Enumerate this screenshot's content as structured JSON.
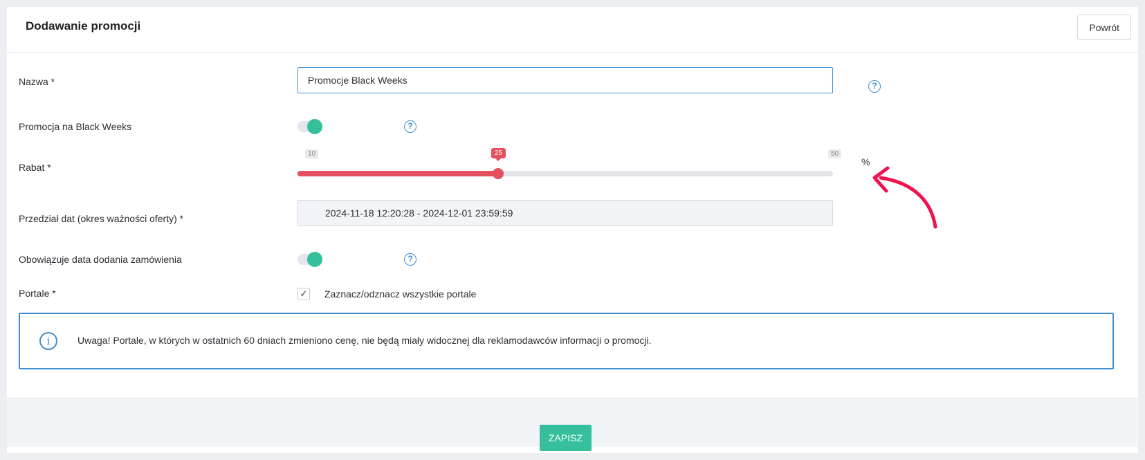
{
  "header": {
    "title": "Dodawanie promocji",
    "back_label": "Powrót"
  },
  "form": {
    "name": {
      "label": "Nazwa *",
      "value": "Promocje Black Weeks"
    },
    "black_weeks": {
      "label": "Promocja na Black Weeks",
      "enabled": true
    },
    "discount": {
      "label": "Rabat *",
      "min": "10",
      "max": "50",
      "value": "25",
      "unit": "%"
    },
    "date_range": {
      "label": "Przedział dat (okres ważności oferty) *",
      "value": "2024-11-18 12:20:28 - 2024-12-01 23:59:59"
    },
    "order_date": {
      "label": "Obowiązuje data dodania zamówienia",
      "enabled": true
    },
    "portals": {
      "label": "Portale *",
      "checkbox_label": "Zaznacz/odznacz wszystkie portale",
      "checked": true
    }
  },
  "notice": {
    "text": "Uwaga! Portale, w których w ostatnich 60 dniach zmieniono cenę, nie będą miały widocznej dla reklamodawców informacji o promocji."
  },
  "footer": {
    "save_label": "ZAPISZ"
  },
  "icons": {
    "help": "question-circle-icon",
    "info": "info-circle-icon",
    "check": "check-icon",
    "annotation": "red-curved-arrow"
  },
  "colors": {
    "accent_blue": "#3d8fd1",
    "toggle_green": "#35bf9b",
    "slider_red": "#e5505e",
    "annotation_red": "#f0134f"
  }
}
